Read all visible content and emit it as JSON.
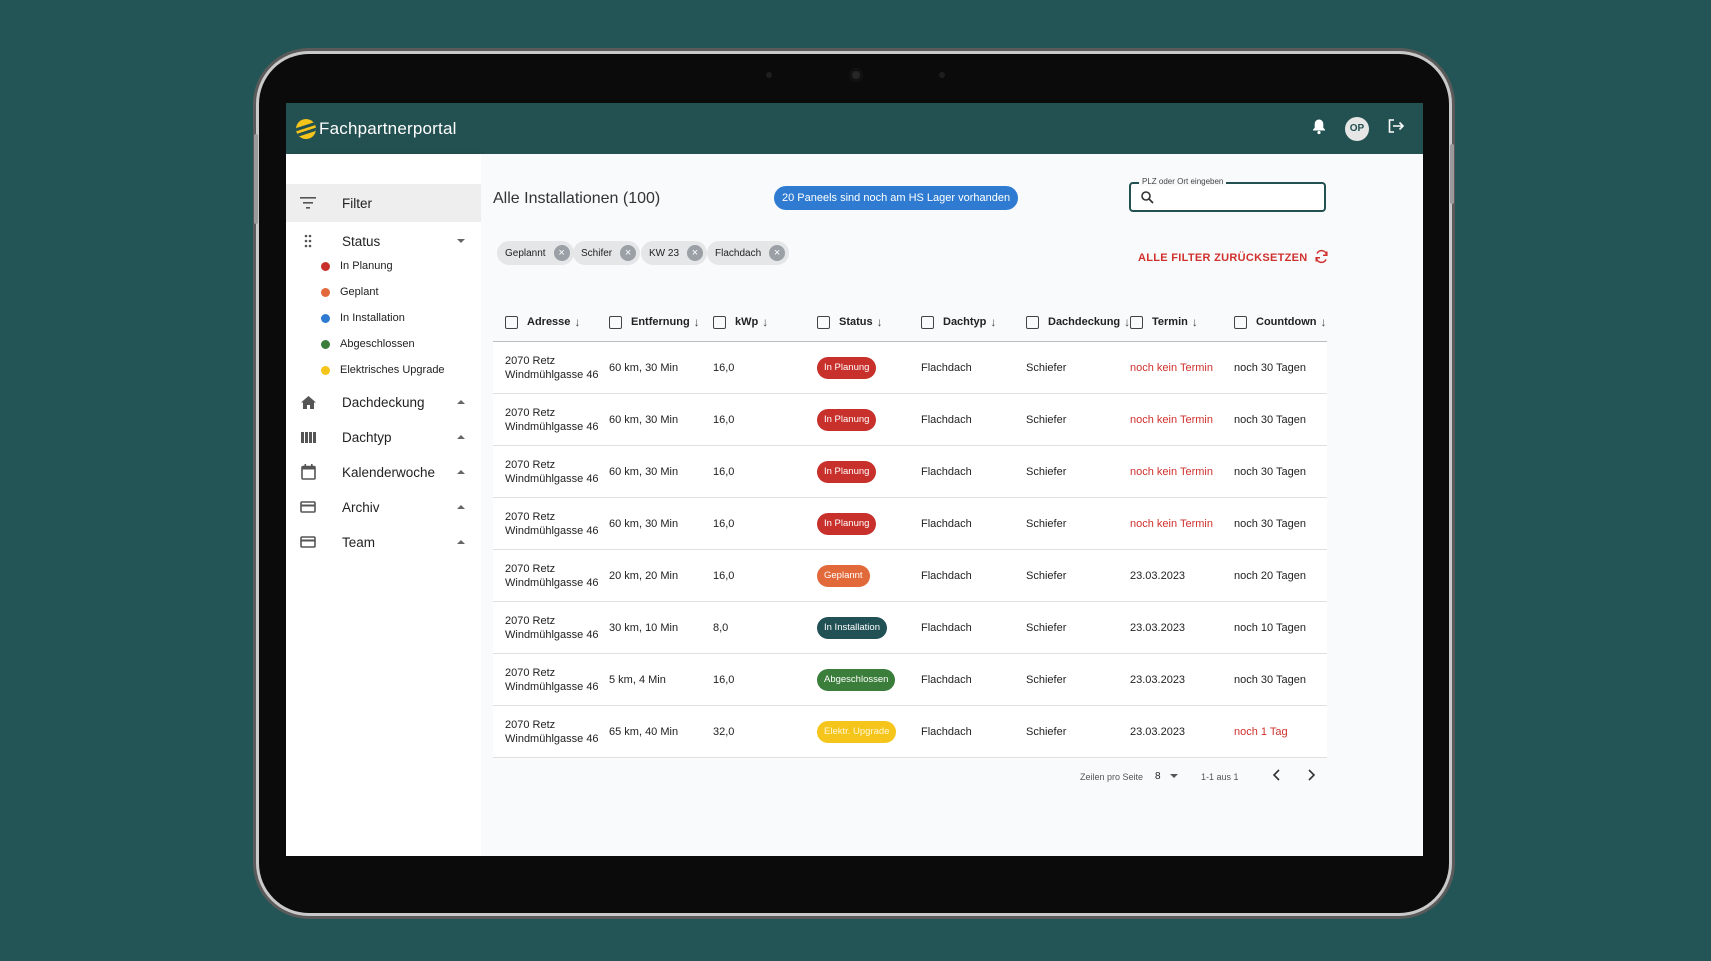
{
  "colors": {
    "background": "#245556",
    "topbar": "#235050",
    "in_planung": "#c8302b",
    "geplant": "#e2693a",
    "in_installation": "#215154",
    "abgeschlossen": "#3b7d3b",
    "elektr_upgrade": "#f5c51b",
    "accent_blue": "#2e7bd1",
    "alert_red": "#d0312d"
  },
  "header": {
    "app_title": "Fachpartnerportal",
    "logo_icon": "sun-logo-icon",
    "avatar_initials": "OP",
    "bell_icon": "bell-icon",
    "logout_icon": "logout-icon"
  },
  "sidebar": {
    "filter_label": "Filter",
    "status_label": "Status",
    "status_items": [
      {
        "label": "In Planung",
        "color": "#c8302b"
      },
      {
        "label": "Geplant",
        "color": "#e2693a"
      },
      {
        "label": "In Installation",
        "color": "#2e7bd1"
      },
      {
        "label": "Abgeschlossen",
        "color": "#3b7d3b"
      },
      {
        "label": "Elektrisches Upgrade",
        "color": "#f5c51b"
      }
    ],
    "sections": [
      {
        "label": "Dachdeckung",
        "icon": "home-icon"
      },
      {
        "label": "Dachtyp",
        "icon": "columns-icon"
      },
      {
        "label": "Kalenderwoche",
        "icon": "calendar-icon"
      },
      {
        "label": "Archiv",
        "icon": "card-icon"
      },
      {
        "label": "Team",
        "icon": "card-icon"
      }
    ]
  },
  "main": {
    "title": "Alle Installationen (100)",
    "stock_badge": "20 Paneels sind noch am HS Lager vorhanden",
    "search_label": "PLZ oder Ort eingeben",
    "search_value": "",
    "chips": [
      "Geplannt",
      "Schifer",
      "KW 23",
      "Flachdach"
    ],
    "reset_label": "ALLE FILTER ZURÜCKSETZEN"
  },
  "table": {
    "columns": [
      "Adresse",
      "Entfernung",
      "kWp",
      "Status",
      "Dachtyp",
      "Dachdeckung",
      "Termin",
      "Countdown"
    ],
    "rows": [
      {
        "city": "2070 Retz",
        "street": "Windmühlgasse 46",
        "distance": "60 km, 30 Min",
        "kwp": "16,0",
        "status": "In Planung",
        "status_color": "#c8302b",
        "status_text_color": "#ffffff",
        "dachtyp": "Flachdach",
        "dachdeckung": "Schiefer",
        "termin": "noch kein Termin",
        "termin_alert": true,
        "countdown": "noch 30 Tagen",
        "countdown_alert": false
      },
      {
        "city": "2070 Retz",
        "street": "Windmühlgasse 46",
        "distance": "60 km, 30 Min",
        "kwp": "16,0",
        "status": "In Planung",
        "status_color": "#c8302b",
        "status_text_color": "#ffffff",
        "dachtyp": "Flachdach",
        "dachdeckung": "Schiefer",
        "termin": "noch kein Termin",
        "termin_alert": true,
        "countdown": "noch 30 Tagen",
        "countdown_alert": false
      },
      {
        "city": "2070 Retz",
        "street": "Windmühlgasse 46",
        "distance": "60 km, 30 Min",
        "kwp": "16,0",
        "status": "In Planung",
        "status_color": "#c8302b",
        "status_text_color": "#ffffff",
        "dachtyp": "Flachdach",
        "dachdeckung": "Schiefer",
        "termin": "noch kein Termin",
        "termin_alert": true,
        "countdown": "noch 30 Tagen",
        "countdown_alert": false
      },
      {
        "city": "2070 Retz",
        "street": "Windmühlgasse 46",
        "distance": "60 km, 30 Min",
        "kwp": "16,0",
        "status": "In Planung",
        "status_color": "#c8302b",
        "status_text_color": "#ffffff",
        "dachtyp": "Flachdach",
        "dachdeckung": "Schiefer",
        "termin": "noch kein Termin",
        "termin_alert": true,
        "countdown": "noch 30 Tagen",
        "countdown_alert": false
      },
      {
        "city": "2070 Retz",
        "street": "Windmühlgasse 46",
        "distance": "20 km, 20 Min",
        "kwp": "16,0",
        "status": "Geplannt",
        "status_color": "#e2693a",
        "status_text_color": "#ffffff",
        "dachtyp": "Flachdach",
        "dachdeckung": "Schiefer",
        "termin": "23.03.2023",
        "termin_alert": false,
        "countdown": "noch 20 Tagen",
        "countdown_alert": false
      },
      {
        "city": "2070 Retz",
        "street": "Windmühlgasse 46",
        "distance": "30 km, 10 Min",
        "kwp": "8,0",
        "status": "In Installation",
        "status_color": "#215154",
        "status_text_color": "#ffffff",
        "dachtyp": "Flachdach",
        "dachdeckung": "Schiefer",
        "termin": "23.03.2023",
        "termin_alert": false,
        "countdown": "noch 10 Tagen",
        "countdown_alert": false
      },
      {
        "city": "2070 Retz",
        "street": "Windmühlgasse 46",
        "distance": "5 km, 4 Min",
        "kwp": "16,0",
        "status": "Abgeschlossen",
        "status_color": "#3b7d3b",
        "status_text_color": "#ffffff",
        "dachtyp": "Flachdach",
        "dachdeckung": "Schiefer",
        "termin": "23.03.2023",
        "termin_alert": false,
        "countdown": "noch 30 Tagen",
        "countdown_alert": false
      },
      {
        "city": "2070 Retz",
        "street": "Windmühlgasse 46",
        "distance": "65 km, 40 Min",
        "kwp": "32,0",
        "status": "Elektr. Upgrade",
        "status_color": "#f5c51b",
        "status_text_color": "#fff7d6",
        "dachtyp": "Flachdach",
        "dachdeckung": "Schiefer",
        "termin": "23.03.2023",
        "termin_alert": false,
        "countdown": "noch 1 Tag",
        "countdown_alert": true
      }
    ]
  },
  "pagination": {
    "rows_per_page_label": "Zeilen pro Seite",
    "rows_per_page_value": "8",
    "range": "1-1 aus 1"
  }
}
